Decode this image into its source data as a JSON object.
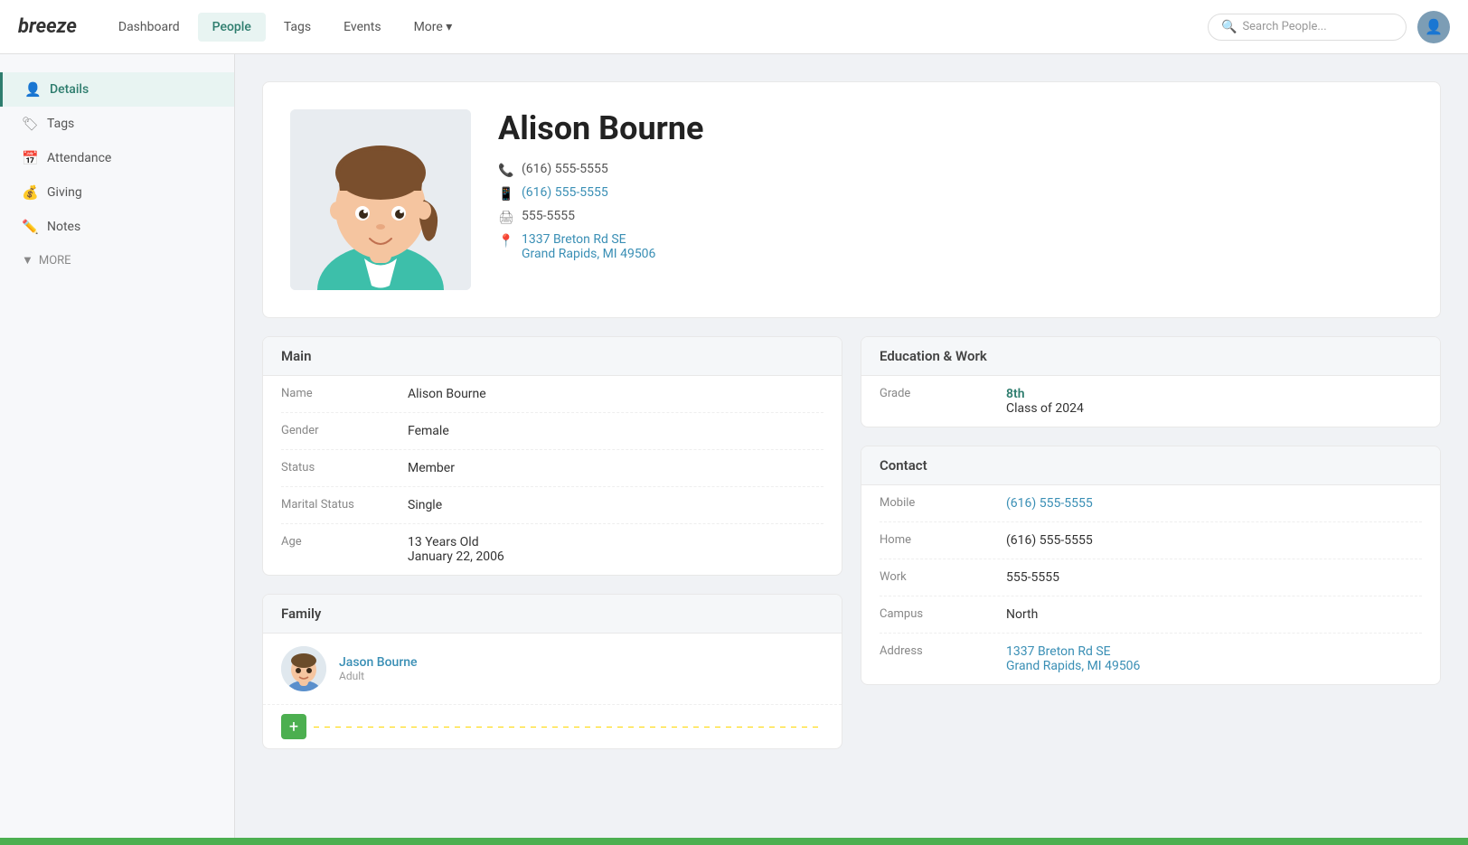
{
  "nav": {
    "logo": "breeze",
    "links": [
      {
        "label": "Dashboard",
        "active": false
      },
      {
        "label": "People",
        "active": true
      },
      {
        "label": "Tags",
        "active": false
      },
      {
        "label": "Events",
        "active": false
      },
      {
        "label": "More ▾",
        "active": false
      }
    ],
    "search_placeholder": "Search People...",
    "user_icon": "👤"
  },
  "sidebar": {
    "items": [
      {
        "label": "Details",
        "icon": "👤",
        "active": true
      },
      {
        "label": "Tags",
        "icon": "🏷",
        "active": false
      },
      {
        "label": "Attendance",
        "icon": "📅",
        "active": false
      },
      {
        "label": "Giving",
        "icon": "💰",
        "active": false
      },
      {
        "label": "Notes",
        "icon": "✏️",
        "active": false
      }
    ],
    "more_label": "MORE"
  },
  "profile": {
    "name": "Alison Bourne",
    "phone_home": "(616) 555-5555",
    "phone_mobile": "(616) 555-5555",
    "fax": "555-5555",
    "address_line1": "1337 Breton Rd SE",
    "address_line2": "Grand Rapids, MI 49506"
  },
  "main_section": {
    "header": "Main",
    "rows": [
      {
        "label": "Name",
        "value": "Alison Bourne"
      },
      {
        "label": "Gender",
        "value": "Female"
      },
      {
        "label": "Status",
        "value": "Member"
      },
      {
        "label": "Marital Status",
        "value": "Single"
      },
      {
        "label": "Age",
        "value": "13 Years Old\nJanuary 22, 2006"
      }
    ]
  },
  "family_section": {
    "header": "Family",
    "members": [
      {
        "name": "Jason Bourne",
        "role": "Adult"
      }
    ]
  },
  "education_section": {
    "header": "Education & Work",
    "rows": [
      {
        "label": "Grade",
        "value": "8th",
        "sub": "Class of 2024"
      }
    ]
  },
  "contact_section": {
    "header": "Contact",
    "rows": [
      {
        "label": "Mobile",
        "value": "(616) 555-5555",
        "link": true
      },
      {
        "label": "Home",
        "value": "(616) 555-5555",
        "link": false
      },
      {
        "label": "Work",
        "value": "555-5555",
        "link": false
      },
      {
        "label": "Campus",
        "value": "North",
        "link": false
      },
      {
        "label": "Address",
        "value": "1337 Breton Rd SE\nGrand Rapids, MI 49506",
        "link": true
      }
    ]
  }
}
